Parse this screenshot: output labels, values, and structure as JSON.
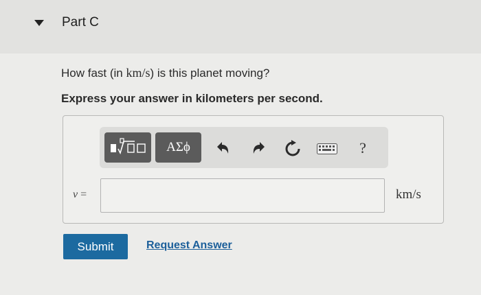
{
  "part": {
    "title": "Part C"
  },
  "question": {
    "prefix": "How fast (in ",
    "unit": "km/s",
    "suffix": ") is this planet moving?",
    "instruction": "Express your answer in kilometers per second."
  },
  "toolbar": {
    "greek_label": "ΑΣϕ",
    "help_label": "?",
    "icons": [
      "templates-icon",
      "greek-symbols-icon",
      "undo-icon",
      "redo-icon",
      "reset-icon",
      "keyboard-icon",
      "help-icon"
    ]
  },
  "answer": {
    "variable": "v",
    "equals": "=",
    "value": "",
    "unit": "km/s"
  },
  "actions": {
    "submit_label": "Submit",
    "request_label": "Request Answer"
  },
  "colors": {
    "submit_bg": "#1c6aa0",
    "link": "#1c5f9a",
    "tool_button_bg": "#5b5b5b"
  }
}
